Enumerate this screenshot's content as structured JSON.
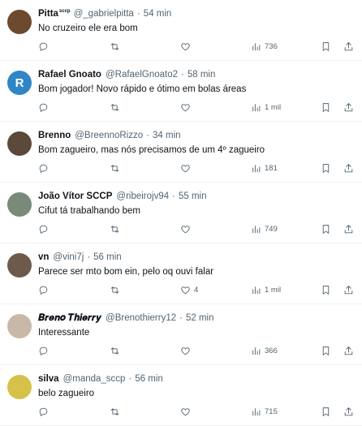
{
  "tweets": [
    {
      "name": "Pitta",
      "name_extra": "sccp",
      "handle": "@_gabrielpitta",
      "time": "54 min",
      "text": "No cruzeiro ele era bom",
      "likes": "",
      "views": "736",
      "avatar_color": "#6b4a2e"
    },
    {
      "name": "Rafael Gnoato",
      "name_extra": "",
      "handle": "@RafaelGnoato2",
      "time": "58 min",
      "text": "Bom jogador! Novo rápido e ótimo em bolas áreas",
      "likes": "",
      "views": "1 mil",
      "avatar_letter": "R",
      "avatar_color": "#2f86c7"
    },
    {
      "name": "Brenno",
      "name_extra": "",
      "handle": "@BreennoRizzo",
      "time": "34 min",
      "text": "Bom zagueiro, mas nós precisamos de um 4º zagueiro",
      "likes": "",
      "views": "181",
      "avatar_color": "#5b4a3a"
    },
    {
      "name": "João Vítor SCCP",
      "name_extra": "",
      "handle": "@ribeirojv94",
      "time": "55 min",
      "text": "Cifut tá trabalhando bem",
      "likes": "",
      "views": "749",
      "avatar_color": "#7a8a7a"
    },
    {
      "name": "vn",
      "name_extra": "",
      "handle": "@vini7j",
      "time": "56 min",
      "text": "Parece ser mto bom ein, pelo oq ouvi falar",
      "likes": "4",
      "views": "1 mil",
      "avatar_color": "#6e5a4a"
    },
    {
      "name": "𝑩𝒓𝒆𝒏𝒐 𝑻𝒉𝒊𝒆𝒓𝒓𝒚",
      "name_extra": "",
      "handle": "@Brenothierry12",
      "time": "52 min",
      "text": "Interessante",
      "likes": "",
      "views": "366",
      "avatar_color": "#c9b8a8"
    },
    {
      "name": "silva",
      "name_extra": "",
      "handle": "@manda_sccp",
      "time": "56 min",
      "text": "belo zagueiro",
      "likes": "",
      "views": "715",
      "avatar_color": "#d6c24a"
    }
  ],
  "dot_separator": "·",
  "icons": {
    "reply": "reply-icon",
    "retweet": "retweet-icon",
    "like": "like-icon",
    "views": "views-icon",
    "bookmark": "bookmark-icon",
    "share": "share-icon"
  },
  "colors": {
    "text": "#0f1419",
    "muted": "#536471",
    "border": "#eff3f4"
  }
}
